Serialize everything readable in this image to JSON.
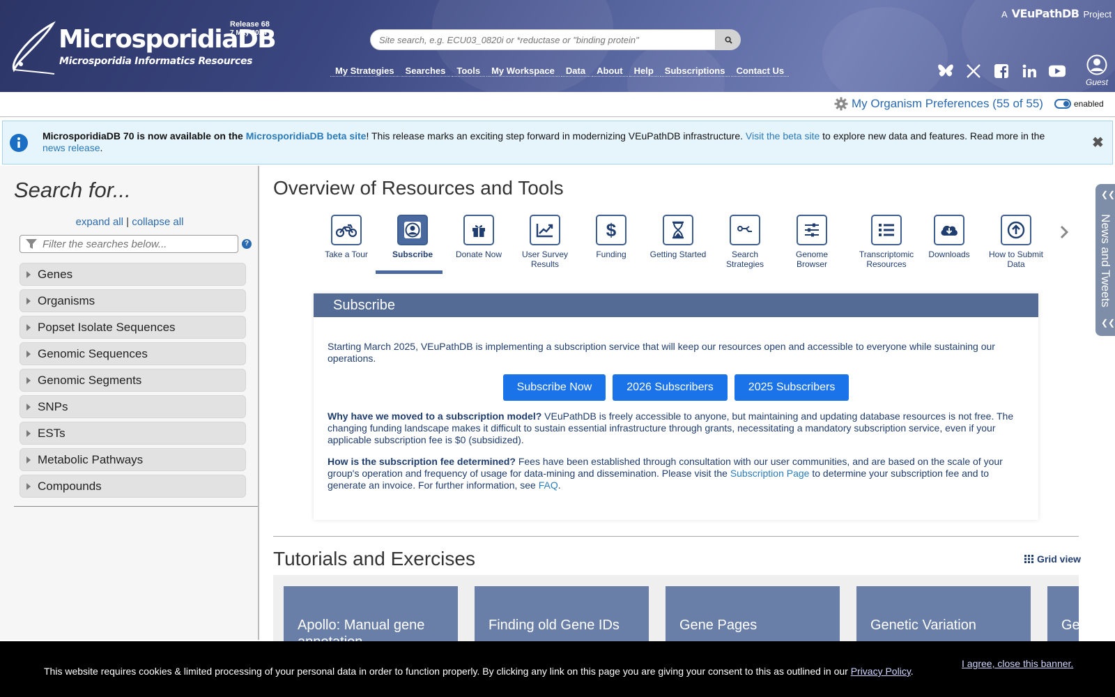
{
  "header": {
    "site_title": "MicrosporidiaDB",
    "site_subtitle": "Microsporidia Informatics Resources",
    "release_label": "Release 68",
    "release_date": "7 May 2024",
    "search_placeholder": "Site search, e.g. ECU03_0820i or *reductase or \"binding protein\"",
    "brand_prefix": "A",
    "brand_name": "VEuPathDB",
    "brand_suffix": "Project",
    "nav": [
      "My Strategies",
      "Searches",
      "Tools",
      "My Workspace",
      "Data",
      "About",
      "Help",
      "Subscriptions",
      "Contact Us"
    ],
    "social_icons": [
      "bluesky-icon",
      "x-twitter-icon",
      "facebook-icon",
      "linkedin-icon",
      "youtube-icon"
    ],
    "user_label": "Guest"
  },
  "prefs": {
    "label": "My Organism Preferences (55 of 55)",
    "toggle_label": "enabled"
  },
  "announcement": {
    "part1": "MicrosporidiaDB 70 is now available on the ",
    "link1": "MicrosporidiaDB beta site",
    "part2": "! This release marks an exciting step forward in modernizing VEuPathDB infrastructure. ",
    "link2": "Visit the beta site",
    "part3": " to explore new data and features. Read more in the ",
    "link3": "news release",
    "part4": "."
  },
  "sidebar": {
    "title": "Search for...",
    "expand_all": "expand all",
    "separator": "|",
    "collapse_all": "collapse all",
    "filter_placeholder": "Filter the searches below...",
    "help_glyph": "?",
    "categories": [
      "Genes",
      "Organisms",
      "Popset Isolate Sequences",
      "Genomic Sequences",
      "Genomic Segments",
      "SNPs",
      "ESTs",
      "Metabolic Pathways",
      "Compounds"
    ]
  },
  "overview": {
    "title": "Overview of Resources and Tools",
    "tools": [
      {
        "label": "Take a Tour",
        "icon": "motorcycle-icon"
      },
      {
        "label": "Subscribe",
        "icon": "user-circle-icon"
      },
      {
        "label": "Donate Now",
        "icon": "gift-icon"
      },
      {
        "label": "User Survey Results",
        "icon": "line-chart-icon"
      },
      {
        "label": "Funding",
        "icon": "dollar-icon"
      },
      {
        "label": "Getting Started",
        "icon": "hourglass-icon"
      },
      {
        "label": "Search Strategies",
        "icon": "strategy-icon"
      },
      {
        "label": "Genome Browser",
        "icon": "sliders-icon"
      },
      {
        "label": "Transcriptomic Resources",
        "icon": "list-icon"
      },
      {
        "label": "Downloads",
        "icon": "cloud-download-icon"
      },
      {
        "label": "How to Submit Data",
        "icon": "upload-arrow-icon"
      }
    ],
    "active_tool": "Subscribe"
  },
  "subscribe": {
    "header": "Subscribe",
    "intro": "Starting March 2025, VEuPathDB is implementing a subscription service that will keep our resources open and accessible to everyone while sustaining our operations.",
    "buttons": [
      "Subscribe Now",
      "2026 Subscribers",
      "2025 Subscribers"
    ],
    "why_q": "Why have we moved to a subscription model?",
    "why_a": " VEuPathDB is freely accessible to anyone, but maintaining and updating database resources is not free. The changing funding landscape makes it difficult to sustain essential infrastructure through grants, necessitating a mandatory subscription service, even if your applicable subscription fee is $0 (subsidized).",
    "fee_q": "How is the subscription fee determined?",
    "fee_a1": " Fees have been established through consultation with our user communities, and are based on the scale of your group's operation and frequency of usage for data-mining and dissemination. Please visit the ",
    "fee_link": "Subscription Page",
    "fee_a2": " to determine your subscription fee and to generate an invoice. For further information, see ",
    "faq_link": "FAQ",
    "fee_end": "."
  },
  "tutorials": {
    "title": "Tutorials and Exercises",
    "grid_view": "Grid view",
    "cards": [
      "Apollo: Manual gene annotation",
      "Finding old Gene IDs",
      "Gene Pages",
      "Genetic Variation",
      "Ge"
    ]
  },
  "news_tab": {
    "label": "News and Tweets"
  },
  "cookie": {
    "text": "This website requires cookies & limited processing of your personal data in order to function properly. By clicking any link on this page you are giving your consent to this as outlined in our ",
    "link": "Privacy Policy",
    "end": ".",
    "close": "I agree, close this banner."
  }
}
